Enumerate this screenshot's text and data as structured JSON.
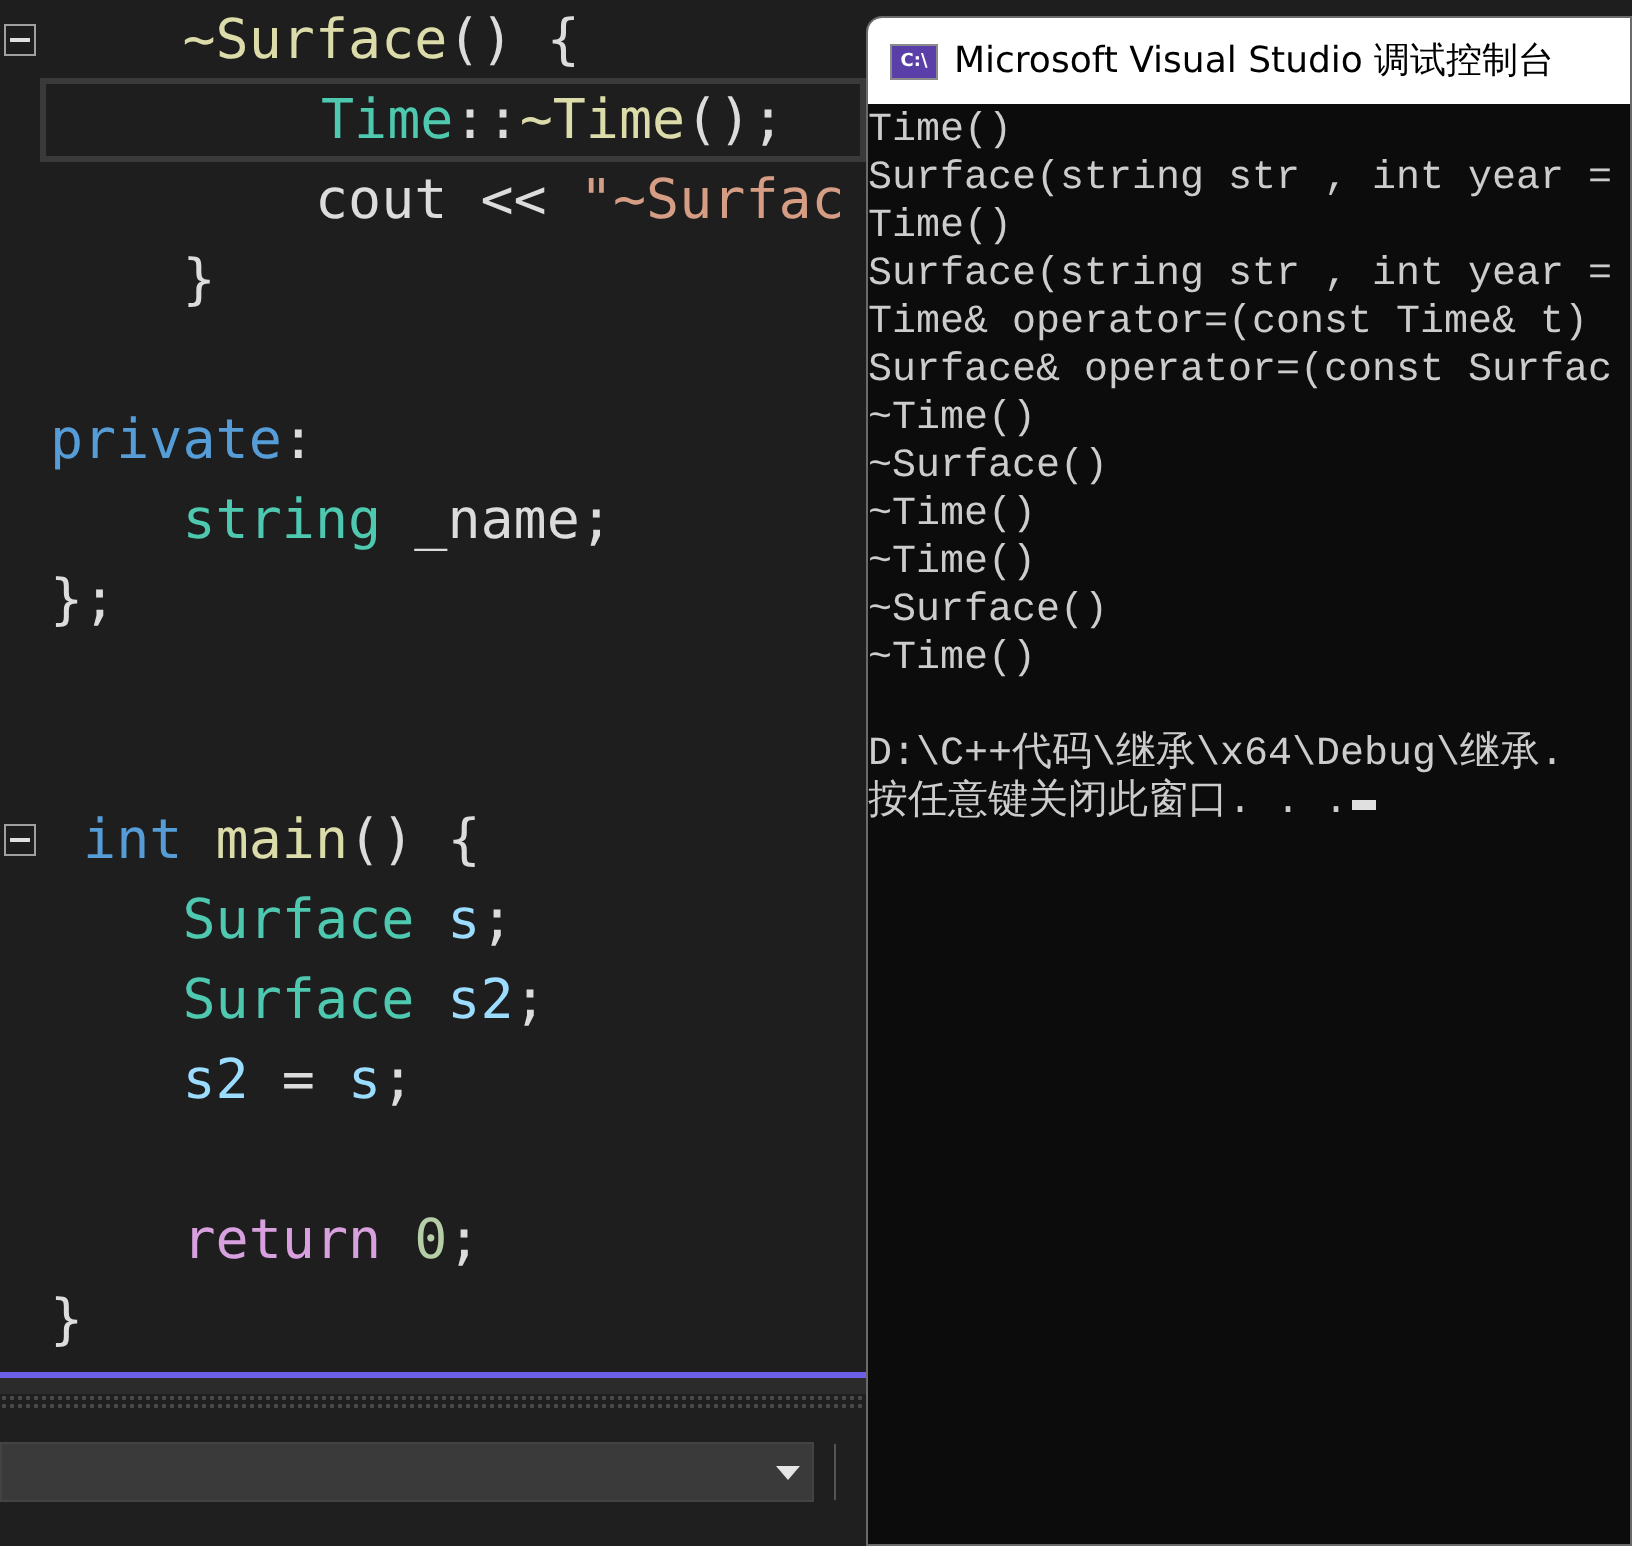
{
  "editor": {
    "lines": [
      {
        "kind": "code",
        "current": false,
        "collapse_marker": true,
        "tokens": [
          {
            "text": "    ~Surface",
            "kind": "function"
          },
          {
            "text": "() {",
            "kind": "plain"
          }
        ]
      },
      {
        "kind": "code",
        "current": true,
        "collapse_marker": false,
        "tokens": [
          {
            "text": "        Time",
            "kind": "type"
          },
          {
            "text": "::",
            "kind": "plain"
          },
          {
            "text": "~Time",
            "kind": "function"
          },
          {
            "text": "();",
            "kind": "plain"
          }
        ]
      },
      {
        "kind": "code",
        "current": false,
        "collapse_marker": false,
        "tokens": [
          {
            "text": "        cout << ",
            "kind": "plain"
          },
          {
            "text": "\"~Surfac",
            "kind": "string"
          }
        ]
      },
      {
        "kind": "code",
        "current": false,
        "collapse_marker": false,
        "tokens": [
          {
            "text": "    }",
            "kind": "plain"
          }
        ]
      },
      {
        "kind": "blank"
      },
      {
        "kind": "code",
        "current": false,
        "collapse_marker": false,
        "tokens": [
          {
            "text": "private",
            "kind": "keyword"
          },
          {
            "text": ":",
            "kind": "plain"
          }
        ]
      },
      {
        "kind": "code",
        "current": false,
        "collapse_marker": false,
        "tokens": [
          {
            "text": "    string",
            "kind": "type"
          },
          {
            "text": " _name;",
            "kind": "plain"
          }
        ]
      },
      {
        "kind": "code",
        "current": false,
        "collapse_marker": false,
        "tokens": [
          {
            "text": "};",
            "kind": "plain"
          }
        ]
      },
      {
        "kind": "blank"
      },
      {
        "kind": "blank"
      },
      {
        "kind": "code",
        "current": false,
        "collapse_marker": true,
        "tokens": [
          {
            "text": " int",
            "kind": "keyword"
          },
          {
            "text": " main",
            "kind": "function"
          },
          {
            "text": "() {",
            "kind": "plain"
          }
        ]
      },
      {
        "kind": "code",
        "current": false,
        "collapse_marker": false,
        "tokens": [
          {
            "text": "    Surface",
            "kind": "type"
          },
          {
            "text": " s",
            "kind": "variable"
          },
          {
            "text": ";",
            "kind": "plain"
          }
        ]
      },
      {
        "kind": "code",
        "current": false,
        "collapse_marker": false,
        "tokens": [
          {
            "text": "    Surface",
            "kind": "type"
          },
          {
            "text": " s2",
            "kind": "variable"
          },
          {
            "text": ";",
            "kind": "plain"
          }
        ]
      },
      {
        "kind": "code",
        "current": false,
        "collapse_marker": false,
        "tokens": [
          {
            "text": "    s2",
            "kind": "variable"
          },
          {
            "text": " = ",
            "kind": "plain"
          },
          {
            "text": "s",
            "kind": "variable"
          },
          {
            "text": ";",
            "kind": "plain"
          }
        ]
      },
      {
        "kind": "blank"
      },
      {
        "kind": "code",
        "current": false,
        "collapse_marker": false,
        "tokens": [
          {
            "text": "    return",
            "kind": "control"
          },
          {
            "text": " 0",
            "kind": "number"
          },
          {
            "text": ";",
            "kind": "plain"
          }
        ]
      },
      {
        "kind": "code",
        "current": false,
        "collapse_marker": false,
        "tokens": [
          {
            "text": "}",
            "kind": "plain"
          }
        ]
      }
    ]
  },
  "console": {
    "title": "Microsoft Visual Studio 调试控制台",
    "icon_text": "C:\\",
    "output_lines": [
      "Time()",
      "Surface(string str , int year =",
      "Time()",
      "Surface(string str , int year =",
      "Time& operator=(const Time& t)",
      "Surface& operator=(const Surfac",
      "~Time()",
      "~Surface()",
      "~Time()",
      "~Time()",
      "~Surface()",
      "~Time()"
    ],
    "exit_lines": [
      "D:\\C++代码\\继承\\x64\\Debug\\继承.",
      "按任意键关闭此窗口. . ."
    ],
    "cursor_visible": true
  }
}
